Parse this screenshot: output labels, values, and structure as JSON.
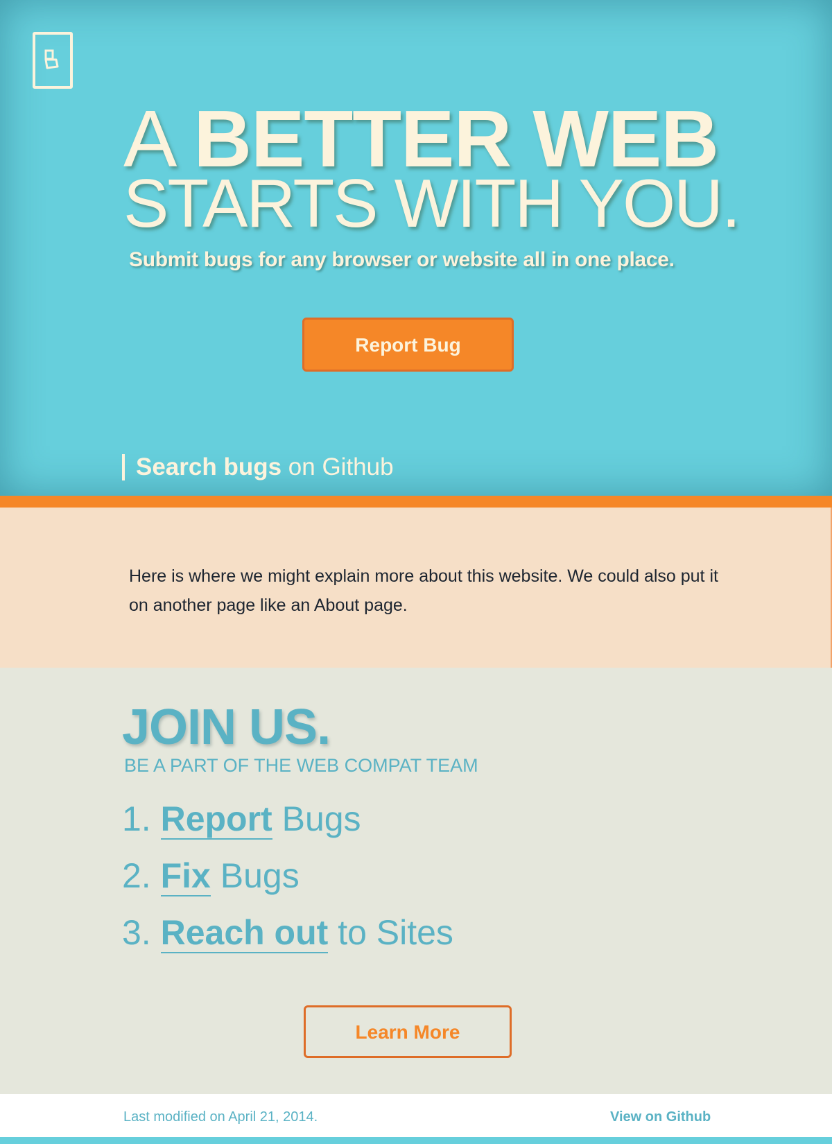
{
  "colors": {
    "hero_background": "#66cfdc",
    "cream_text": "#fcf3dc",
    "accent_orange": "#f58728",
    "about_background": "#f6dfc7",
    "join_background": "#e5e7dc",
    "teal_text": "#5ab2c4",
    "footer_background": "#ffffff"
  },
  "hero": {
    "logo_icon": "compat-logo-icon",
    "headline_line1_light": "A ",
    "headline_line1_bold": "BETTER WEB",
    "headline_line2": "STARTS WITH YOU.",
    "tagline": "Submit bugs for any browser or website all in one place.",
    "report_button": "Report Bug",
    "search_bold": "Search bugs",
    "search_light": " on Github"
  },
  "about": {
    "text": "Here is where we might explain more about this website.  We could also put it on another page like an About page."
  },
  "join": {
    "title": "JOIN US.",
    "subtitle": "BE A PART OF THE WEB COMPAT TEAM",
    "steps": [
      {
        "number": "1. ",
        "link": "Report",
        "rest": " Bugs"
      },
      {
        "number": "2. ",
        "link": "Fix",
        "rest": " Bugs"
      },
      {
        "number": "3. ",
        "link": "Reach out",
        "rest": " to Sites"
      }
    ],
    "learn_more_button": "Learn More"
  },
  "footer": {
    "last_modified": "Last modified on April 21, 2014.",
    "github_link": "View on Github"
  }
}
